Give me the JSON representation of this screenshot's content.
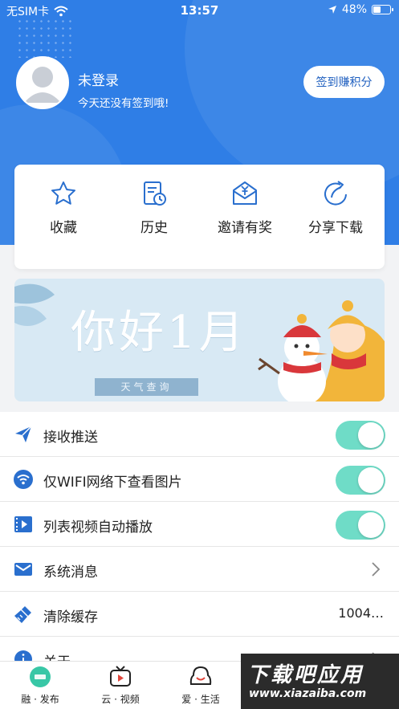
{
  "status_bar": {
    "carrier": "无SIM卡",
    "time": "13:57",
    "battery": "48%",
    "battery_level": 0.48
  },
  "profile": {
    "name": "未登录",
    "tip": "今天还没有签到哦!",
    "signin_button": "签到赚积分"
  },
  "quick_actions": [
    {
      "label": "收藏",
      "icon": "star-icon"
    },
    {
      "label": "历史",
      "icon": "history-icon"
    },
    {
      "label": "邀请有奖",
      "icon": "invite-icon"
    },
    {
      "label": "分享下载",
      "icon": "share-icon"
    }
  ],
  "banner": {
    "title": "你好1月",
    "subtitle": "天气查询"
  },
  "settings": [
    {
      "label": "接收推送",
      "icon": "send-icon",
      "control": "toggle",
      "on": true
    },
    {
      "label": "仅WIFI网络下查看图片",
      "icon": "wifi-icon",
      "control": "toggle",
      "on": true
    },
    {
      "label": "列表视频自动播放",
      "icon": "video-icon",
      "control": "toggle",
      "on": true
    },
    {
      "label": "系统消息",
      "icon": "mail-icon",
      "control": "chevron"
    },
    {
      "label": "清除缓存",
      "icon": "broom-icon",
      "control": "value",
      "value": "1004…"
    },
    {
      "label": "关于",
      "icon": "info-icon",
      "control": "chevron"
    }
  ],
  "tabs": [
    {
      "label": "融 · 发布",
      "icon": "home-icon"
    },
    {
      "label": "云 · 视频",
      "icon": "tv-icon"
    },
    {
      "label": "爱 · 生活",
      "icon": "life-icon"
    }
  ],
  "watermark": {
    "line1": "下载吧应用",
    "line2": "www.xiazaiba.com"
  },
  "colors": {
    "header": "#2f7ee6",
    "accent": "#1f5fbf",
    "toggle_on": "#6fdcc7",
    "icon": "#2a6fce"
  }
}
